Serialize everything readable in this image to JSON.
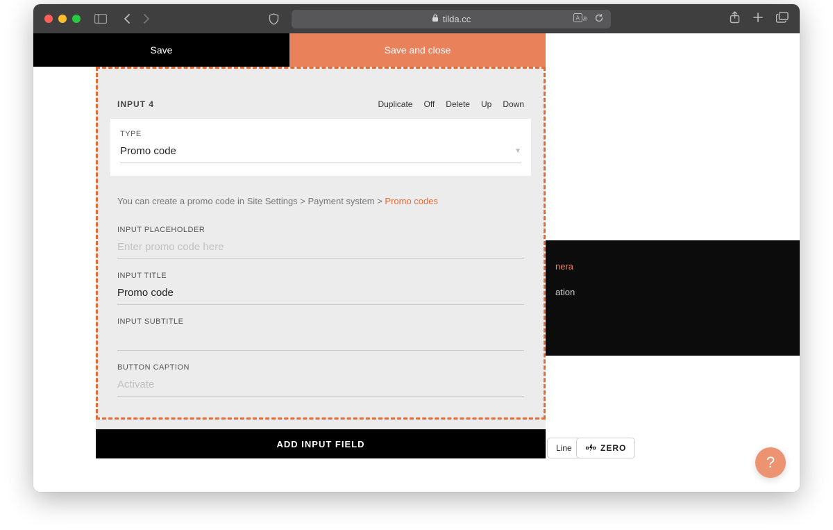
{
  "browser": {
    "url_host": "tilda.cc"
  },
  "savebar": {
    "save": "Save",
    "save_close": "Save and close"
  },
  "input_block": {
    "title": "INPUT 4",
    "actions": {
      "duplicate": "Duplicate",
      "off": "Off",
      "delete": "Delete",
      "up": "Up",
      "down": "Down"
    },
    "type_label": "TYPE",
    "type_value": "Promo code",
    "hint_prefix": "You can create a promo code in Site Settings > Payment system > ",
    "hint_link": "Promo codes",
    "placeholder_label": "INPUT PLACEHOLDER",
    "placeholder_ph": "Enter promo code here",
    "title_label": "INPUT TITLE",
    "title_value": "Promo code",
    "subtitle_label": "INPUT SUBTITLE",
    "subtitle_value": "",
    "caption_label": "BUTTON CAPTION",
    "caption_ph": "Activate"
  },
  "add_button": "ADD INPUT FIELD",
  "preview": {
    "line1_suffix": "nera",
    "line2_suffix": "ation"
  },
  "pills": {
    "line": "Line",
    "zero": "ZERO"
  },
  "help": "?"
}
